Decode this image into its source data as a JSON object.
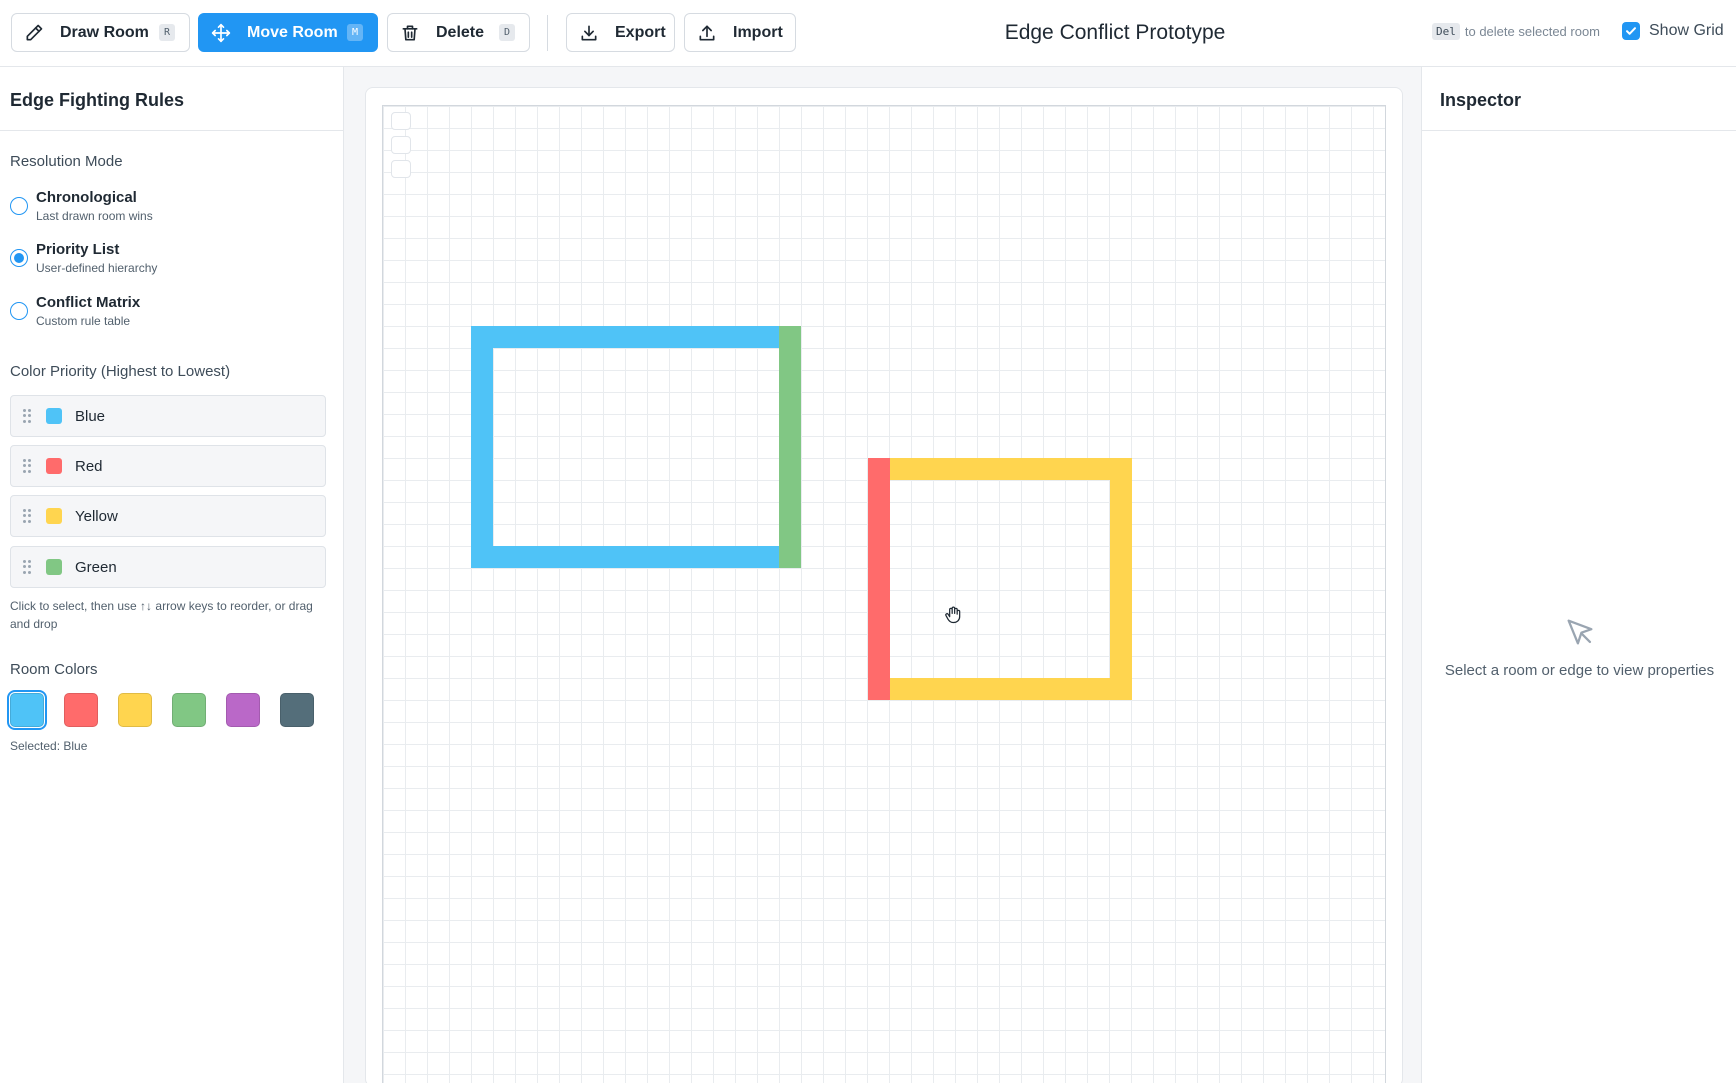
{
  "toolbar": {
    "draw_label": "Draw Room",
    "draw_key": "R",
    "move_label": "Move Room",
    "move_key": "M",
    "delete_label": "Delete",
    "delete_key": "D",
    "export_label": "Export",
    "import_label": "Import",
    "title": "Edge Conflict Prototype",
    "hint_key": "Del",
    "hint_text": "to delete selected room",
    "grid_label": "Show Grid",
    "grid_checked": true
  },
  "left_panel": {
    "title": "Edge Fighting Rules",
    "resolution_title": "Resolution Mode",
    "modes": [
      {
        "label": "Chronological",
        "sub": "Last drawn room wins",
        "selected": false
      },
      {
        "label": "Priority List",
        "sub": "User-defined hierarchy",
        "selected": true
      },
      {
        "label": "Conflict Matrix",
        "sub": "Custom rule table",
        "selected": false
      }
    ],
    "priority_title": "Color Priority (Highest to Lowest)",
    "priority": [
      {
        "label": "Blue",
        "color": "#4fc3f7"
      },
      {
        "label": "Red",
        "color": "#ff6b6b"
      },
      {
        "label": "Yellow",
        "color": "#ffd54f"
      },
      {
        "label": "Green",
        "color": "#81c784"
      }
    ],
    "help_text": "Click to select, then use ↑↓ arrow keys to reorder, or drag and drop",
    "colors_title": "Room Colors",
    "colors": [
      "#4fc3f7",
      "#ff6b6b",
      "#ffd54f",
      "#81c784",
      "#ba68c8",
      "#546e7a"
    ],
    "selected_text": "Selected: Blue"
  },
  "inspector": {
    "title": "Inspector",
    "empty_text": "Select a room or edge to view properties"
  },
  "theme": {
    "accent": "#2196f3",
    "room_blue": "#4fc3f7",
    "room_red": "#ff6b6b",
    "room_yellow": "#ffd54f",
    "room_green": "#81c784"
  }
}
